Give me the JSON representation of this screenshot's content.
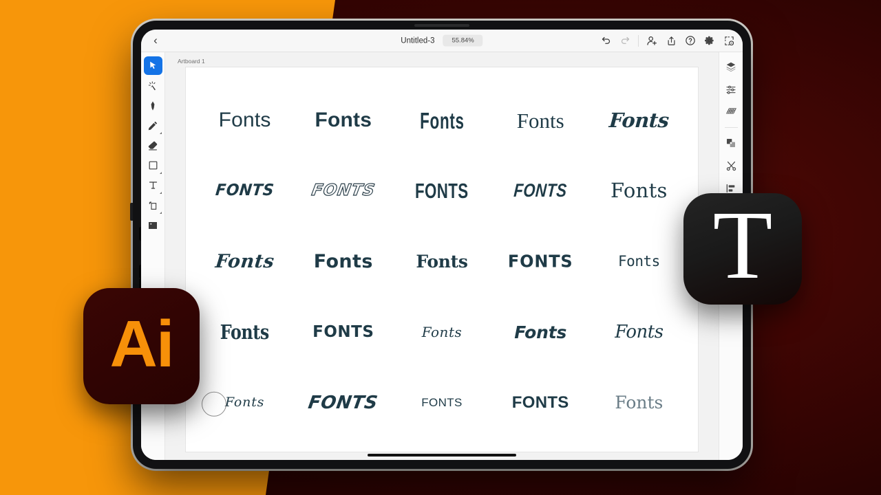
{
  "app": {
    "name": "Adobe Illustrator",
    "badge_label": "Ai",
    "type_badge_label": "T"
  },
  "topbar": {
    "back_label": "‹",
    "document_title": "Untitled-3",
    "zoom_level": "55.84%",
    "actions": [
      {
        "name": "undo-button",
        "icon": "undo-icon",
        "enabled": true
      },
      {
        "name": "redo-button",
        "icon": "redo-icon",
        "enabled": false
      },
      {
        "name": "invite-button",
        "icon": "add-person-icon",
        "enabled": true
      },
      {
        "name": "share-button",
        "icon": "share-icon",
        "enabled": true
      },
      {
        "name": "help-button",
        "icon": "help-icon",
        "enabled": true
      },
      {
        "name": "settings-button",
        "icon": "gear-icon",
        "enabled": true
      },
      {
        "name": "view-mode-button",
        "icon": "canvas-view-icon",
        "enabled": true
      }
    ]
  },
  "toolbar": {
    "tools": [
      {
        "name": "selection-tool",
        "icon": "cursor-arrow-icon",
        "active": true,
        "has_flyout": false
      },
      {
        "name": "direct-selection-tool",
        "icon": "magic-wand-icon",
        "active": false,
        "has_flyout": false
      },
      {
        "name": "pen-tool",
        "icon": "pen-icon",
        "active": false,
        "has_flyout": false
      },
      {
        "name": "pencil-tool",
        "icon": "pencil-icon",
        "active": false,
        "has_flyout": true
      },
      {
        "name": "eraser-tool",
        "icon": "eraser-icon",
        "active": false,
        "has_flyout": false
      },
      {
        "name": "rectangle-tool",
        "icon": "rectangle-icon",
        "active": false,
        "has_flyout": true
      },
      {
        "name": "type-tool",
        "icon": "type-t-icon",
        "active": false,
        "has_flyout": true
      },
      {
        "name": "transform-tool",
        "icon": "transform-icon",
        "active": false,
        "has_flyout": true
      },
      {
        "name": "image-tool",
        "icon": "image-icon",
        "active": false,
        "has_flyout": false
      }
    ]
  },
  "panel": {
    "items": [
      {
        "name": "layers-panel-button",
        "icon": "layers-icon"
      },
      {
        "name": "properties-panel-button",
        "icon": "sliders-icon"
      },
      {
        "name": "grid-panel-button",
        "icon": "grid-perspective-icon"
      },
      {
        "name": "pathfinder-panel-button",
        "icon": "combine-shapes-icon"
      },
      {
        "name": "scissors-tool-button",
        "icon": "scissors-icon"
      },
      {
        "name": "align-panel-button",
        "icon": "align-icon"
      },
      {
        "name": "transform-panel-button",
        "icon": "transform-box-icon"
      },
      {
        "name": "type-panel-button",
        "icon": "type-t-icon"
      },
      {
        "name": "path-panel-button",
        "icon": "path-node-icon"
      },
      {
        "name": "effects-panel-button",
        "icon": "effects-gear-icon"
      }
    ]
  },
  "canvas": {
    "artboard_label": "Artboard 1",
    "text_color": "#1f3b47",
    "samples": [
      {
        "text": "Fonts",
        "style": "v-sans",
        "style_name": "sans-regular"
      },
      {
        "text": "Fonts",
        "style": "v-sansbold",
        "style_name": "sans-bold"
      },
      {
        "text": "Fonts",
        "style": "v-cond",
        "style_name": "condensed-bold"
      },
      {
        "text": "Fonts",
        "style": "v-serif",
        "style_name": "serif-regular"
      },
      {
        "text": "Fonts",
        "style": "v-script1",
        "style_name": "decorative-script"
      },
      {
        "text": "FONTS",
        "style": "v-ital",
        "style_name": "italic-bold-caps"
      },
      {
        "text": "FONTS",
        "style": "v-outline",
        "style_name": "outlined-italic-caps"
      },
      {
        "text": "FONTS",
        "style": "v-cond2",
        "style_name": "condensed-heavy-caps"
      },
      {
        "text": "FONTS",
        "style": "v-italcond",
        "style_name": "italic-condensed-caps"
      },
      {
        "text": "Fonts",
        "style": "v-serif2",
        "style_name": "slab-serif"
      },
      {
        "text": "Fonts",
        "style": "v-script2",
        "style_name": "brush-script"
      },
      {
        "text": "Fonts",
        "style": "v-round",
        "style_name": "rounded-bold"
      },
      {
        "text": "Fonts",
        "style": "v-slab",
        "style_name": "bold-slab"
      },
      {
        "text": "FONTS",
        "style": "v-comic",
        "style_name": "comic-heavy-caps"
      },
      {
        "text": "Fonts",
        "style": "v-hand",
        "style_name": "handwritten"
      },
      {
        "text": "Fonts",
        "style": "v-gothic",
        "style_name": "gothic-fantasy"
      },
      {
        "text": "FONTS",
        "style": "v-blocky",
        "style_name": "blocky-caps"
      },
      {
        "text": "Fonts",
        "style": "v-thin1",
        "style_name": "thin-calligraphy"
      },
      {
        "text": "Fonts",
        "style": "v-bolditl",
        "style_name": "bold-italic-rounded"
      },
      {
        "text": "Fonts",
        "style": "v-brushlt",
        "style_name": "light-brush"
      },
      {
        "text": "Fonts",
        "style": "v-signature",
        "style_name": "signature-with-circle"
      },
      {
        "text": "FONTS",
        "style": "v-grunge",
        "style_name": "grunge-brush-caps"
      },
      {
        "text": "FONTS",
        "style": "v-smallcaps",
        "style_name": "small-caps"
      },
      {
        "text": "FONTS",
        "style": "v-heavy",
        "style_name": "heavy-grotesque-caps"
      },
      {
        "text": "Fonts",
        "style": "v-didone",
        "style_name": "didone-light-serif"
      }
    ]
  },
  "colors": {
    "background_orange": "#f7960a",
    "background_maroon": "#3d0604",
    "accent_blue": "#1473e6",
    "ai_orange": "#f79009",
    "ai_badge_bg": "#300403",
    "canvas_text": "#1f3b47"
  }
}
